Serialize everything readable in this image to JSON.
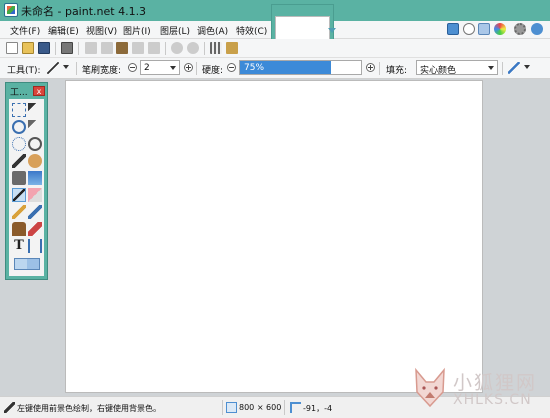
{
  "window": {
    "title": "未命名 - paint.net 4.1.3"
  },
  "menu": {
    "items": [
      {
        "label": "文件(F)"
      },
      {
        "label": "编辑(E)"
      },
      {
        "label": "视图(V)"
      },
      {
        "label": "图片(I)"
      },
      {
        "label": "图层(L)"
      },
      {
        "label": "调色(A)"
      },
      {
        "label": "特效(C)"
      }
    ]
  },
  "tool_options": {
    "tool_label": "工具(T):",
    "brush_width_label": "笔刷宽度:",
    "brush_width_value": "2",
    "hardness_label": "硬度:",
    "hardness_value": "75%",
    "hardness_fraction": 0.75,
    "fill_label": "填充:",
    "fill_value": "实心颜色"
  },
  "tools_window": {
    "title": "工...",
    "close_glyph": "x"
  },
  "status": {
    "hint": "左键使用前景色绘制，右键使用背景色。",
    "image_size": "800 × 600",
    "cursor_pos": "-91，-4"
  },
  "watermark": {
    "cn": "小狐狸网",
    "en": "XHLKS.CN"
  },
  "colors": {
    "titlebar": "#5ab2a3",
    "selection": "#3c8ad8",
    "close": "#d9453b"
  }
}
